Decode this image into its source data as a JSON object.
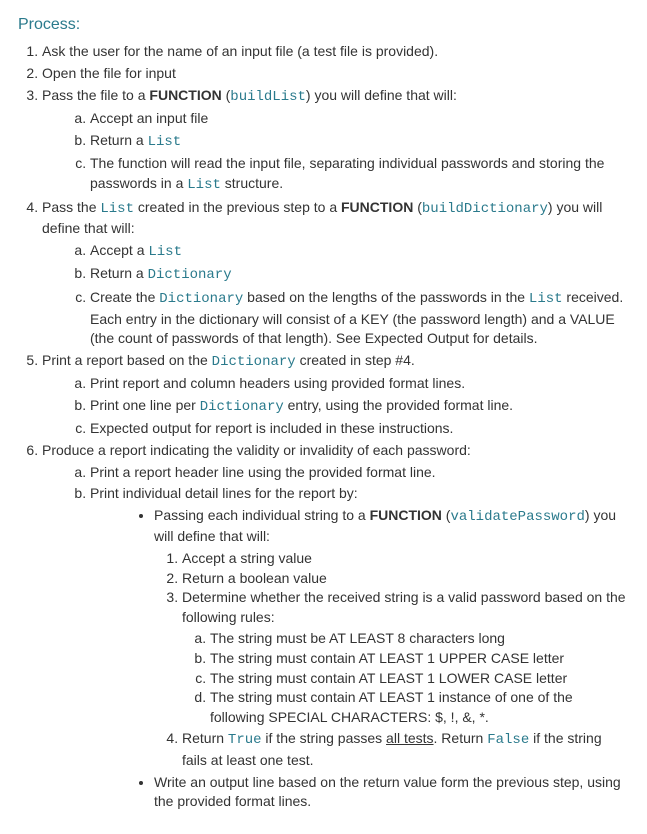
{
  "heading": "Process:",
  "s1": "Ask the user for the name of an input file (a test file is provided).",
  "s2": "Open the file for input",
  "s3a": "Pass the file to a ",
  "s3b": "FUNCTION",
  "s3c": " (",
  "s3d": "buildList",
  "s3e": ") you will define that will:",
  "s3_a": "Accept an input file",
  "s3_b_a": "Return a ",
  "s3_b_b": "List",
  "s3_c_a": "The function will read the input file, separating individual passwords and storing the passwords in a ",
  "s3_c_b": "List",
  "s3_c_c": " structure.",
  "s4a": "Pass the ",
  "s4b": "List",
  "s4c": " created in the previous step to a ",
  "s4d": "FUNCTION",
  "s4e": " (",
  "s4f": "buildDictionary",
  "s4g": ") you will define that will:",
  "s4_a_a": "Accept a ",
  "s4_a_b": "List",
  "s4_b_a": "Return a ",
  "s4_b_b": "Dictionary",
  "s4_c_a": "Create the ",
  "s4_c_b": "Dictionary",
  "s4_c_c": " based on the lengths of the passwords in the ",
  "s4_c_d": "List",
  "s4_c_e": " received. Each entry in the dictionary will consist of a KEY (the password length) and a VALUE (the count of passwords of that length). See Expected Output for details.",
  "s5a": "Print a report based on the ",
  "s5b": "Dictionary",
  "s5c": " created in step #4.",
  "s5_a": "Print report and column headers using provided format lines.",
  "s5_b_a": "Print one line per ",
  "s5_b_b": "Dictionary",
  "s5_b_c": " entry, using the provided format line.",
  "s5_c": "Expected output for report is included in these instructions.",
  "s6": "Produce a report indicating the validity or invalidity of each password:",
  "s6_a": "Print a report header line using the provided format line.",
  "s6_b": "Print individual detail lines for the report by:",
  "b1a": "Passing each individual string to a ",
  "b1b": "FUNCTION",
  "b1c": " (",
  "b1d": "validatePassword",
  "b1e": ") you will define that will:",
  "b1_1": "Accept a string value",
  "b1_2": "Return a boolean value",
  "b1_3": "Determine whether the received string is a valid password based on the following rules:",
  "b1_3_a": "The string must be AT LEAST 8 characters long",
  "b1_3_b": "The string must contain AT LEAST 1 UPPER CASE letter",
  "b1_3_c": "The string must contain AT LEAST 1 LOWER CASE letter",
  "b1_3_d": "The string must contain AT LEAST 1 instance of one of the following SPECIAL CHARACTERS: $, !, &, *.",
  "b1_4a": "Return ",
  "b1_4b": "True",
  "b1_4c": " if the string passes ",
  "b1_4d": "all tests",
  "b1_4e": ". Return ",
  "b1_4f": "False",
  "b1_4g": " if the string fails at least one test.",
  "b2": "Write an output line based on the return value form the previous step, using the provided format lines."
}
